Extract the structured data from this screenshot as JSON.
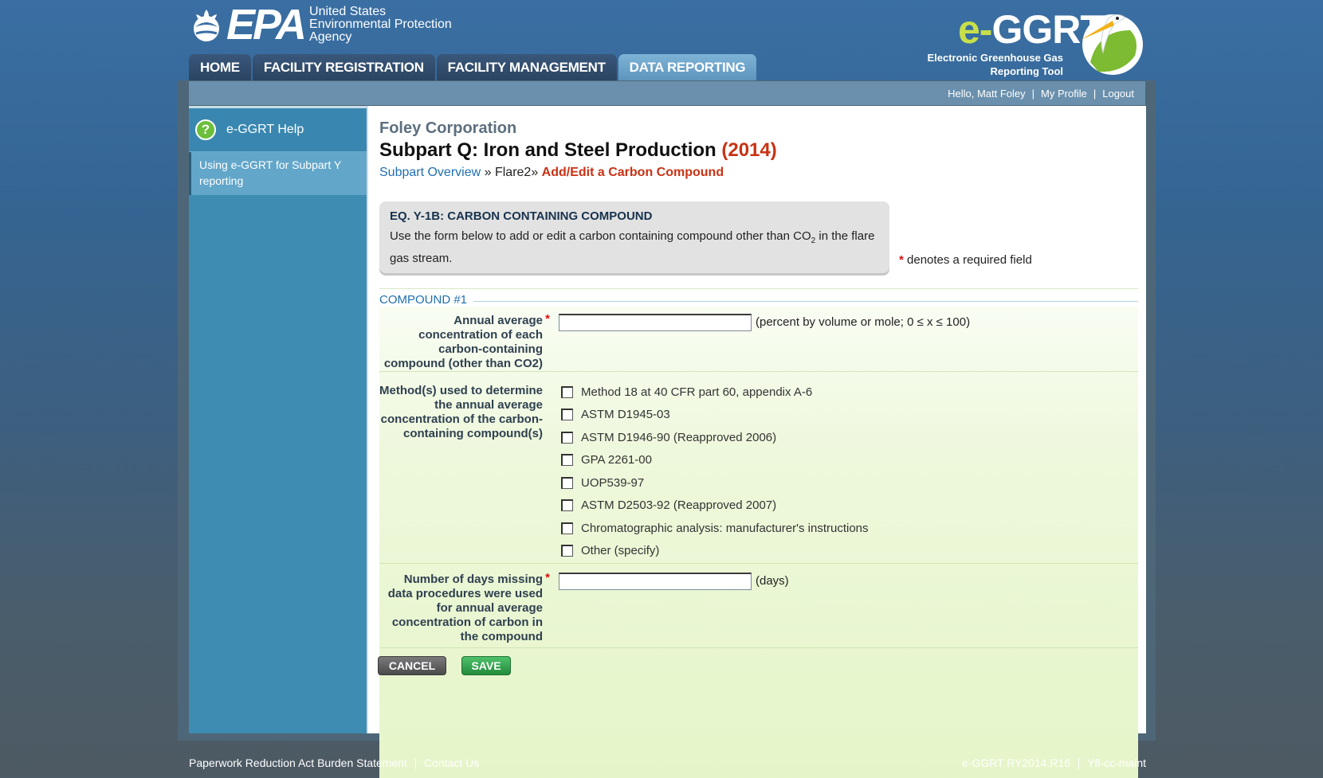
{
  "header": {
    "epa_word": "EPA",
    "epa_agency": [
      "United States",
      "Environmental Protection",
      "Agency"
    ],
    "eggrt_e": "e-",
    "eggrt_rest": "GGRT",
    "eggrt_subtitle": [
      "Electronic Greenhouse Gas",
      "Reporting Tool"
    ]
  },
  "nav": {
    "tabs": [
      {
        "label": "HOME"
      },
      {
        "label": "FACILITY REGISTRATION"
      },
      {
        "label": "FACILITY MANAGEMENT"
      },
      {
        "label": "DATA REPORTING"
      }
    ]
  },
  "userbar": {
    "greeting": "Hello, Matt Foley",
    "my_profile": "My Profile",
    "logout": "Logout"
  },
  "sidebar": {
    "help_label": "e-GGRT Help",
    "link": "Using e-GGRT for Subpart Y reporting"
  },
  "page": {
    "company": "Foley Corporation",
    "subpart_title": "Subpart Q: Iron and Steel Production",
    "year": "(2014)",
    "breadcrumb": {
      "overview": "Subpart Overview",
      "sep1": " » ",
      "flare": "Flare2",
      "sep2": "» ",
      "current": "Add/Edit a Carbon Compound"
    },
    "eqbox": {
      "title": "EQ. Y-1B: CARBON CONTAINING COMPOUND",
      "text_before": "Use the form below to add or edit a carbon containing compound other than CO",
      "text_sub": "2",
      "text_after": " in the flare gas stream."
    },
    "required_star": "*",
    "required_note": " denotes a required field"
  },
  "form": {
    "legend": "COMPOUND #1",
    "concentration": {
      "label": "Annual average concentration of each carbon-containing compound (other than CO2)",
      "value": "",
      "hint": "(percent by volume or mole; 0 ≤ x ≤ 100)"
    },
    "methods": {
      "label": "Method(s) used to determine the annual average concentration of the carbon-containing compound(s)",
      "options": [
        {
          "label": "Method 18 at 40 CFR part 60, appendix A-6",
          "checked": false
        },
        {
          "label": "ASTM D1945-03",
          "checked": false
        },
        {
          "label": "ASTM D1946-90 (Reapproved 2006)",
          "checked": false
        },
        {
          "label": "GPA 2261-00",
          "checked": false
        },
        {
          "label": "UOP539-97",
          "checked": false
        },
        {
          "label": "ASTM D2503-92 (Reapproved 2007)",
          "checked": false
        },
        {
          "label": "Chromatographic analysis: manufacturer's instructions",
          "checked": false
        },
        {
          "label": "Other (specify)",
          "checked": false
        }
      ]
    },
    "missing_days": {
      "label": "Number of days missing data procedures were used for annual average concentration of carbon in the compound",
      "value": "",
      "hint": "(days)"
    },
    "cancel_label": "CANCEL",
    "save_label": "SAVE"
  },
  "footer": {
    "paperwork": "Paperwork Reduction Act Burden Statement",
    "contact": "Contact Us",
    "version": "e-GGRT RY2014.R16",
    "server": "Yfl-cc-maint"
  },
  "colors": {
    "accent_red": "#c83214",
    "link_blue": "#1f6fb1",
    "save_green": "#238c3c"
  }
}
